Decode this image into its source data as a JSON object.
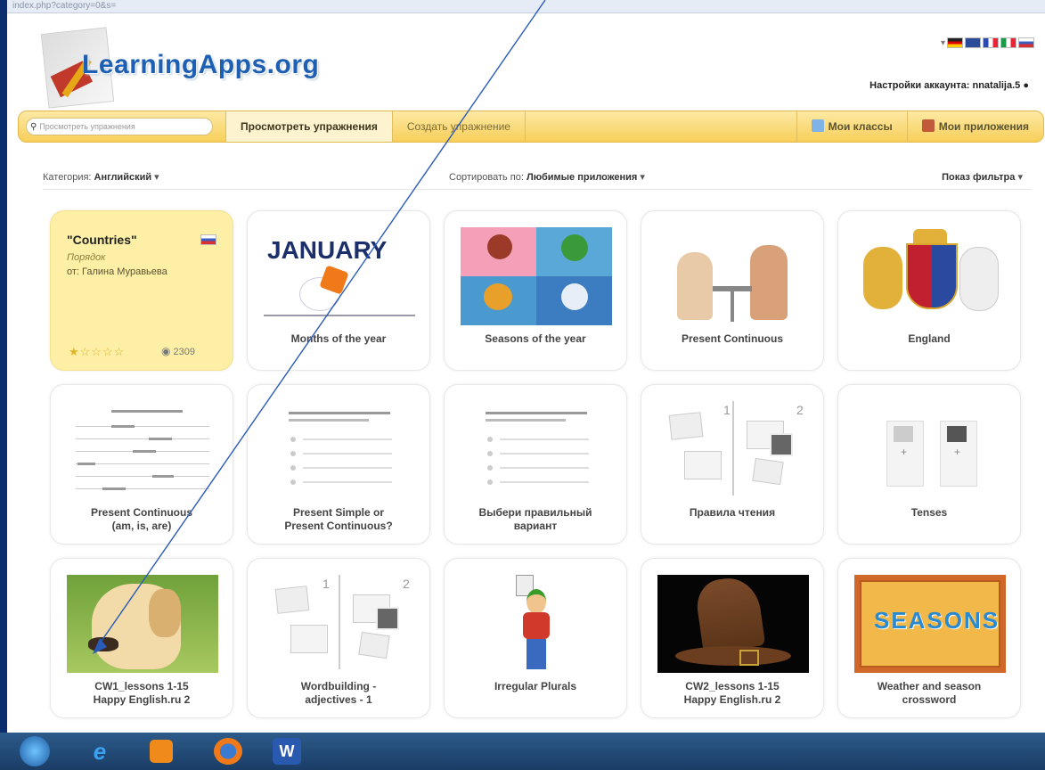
{
  "browser": {
    "url": "index.php?category=0&s="
  },
  "logo": {
    "text": "LearningApps.org"
  },
  "account": {
    "label": "Настройки аккаунта:",
    "user": "nnatalija.5"
  },
  "nav": {
    "search_placeholder": "Просмотреть упражнения",
    "browse": "Просмотреть упражнения",
    "create": "Создать упражнение",
    "classes": "Мои классы",
    "apps": "Мои приложения"
  },
  "filters": {
    "category_label": "Категория:",
    "category_value": "Английский",
    "sort_label": "Сортировать по:",
    "sort_value": "Любимые приложения",
    "filter_toggle": "Показ фильтра"
  },
  "featured": {
    "title": "\"Countries\"",
    "type": "Порядок",
    "author": "от: Галина Муравьева",
    "views": "2309",
    "rating": 1
  },
  "cards": [
    {
      "title1": "Months of the year",
      "title2": "",
      "thumb": "january"
    },
    {
      "title1": "Seasons of the year",
      "title2": "",
      "thumb": "seasons-trees"
    },
    {
      "title1": "Present Continuous",
      "title2": "",
      "thumb": "people"
    },
    {
      "title1": "England",
      "title2": "",
      "thumb": "coat-of-arms"
    },
    {
      "title1": "Present Continuous",
      "title2": "(am, is, are)",
      "thumb": "lines"
    },
    {
      "title1": "Present Simple or",
      "title2": "Present Continuous?",
      "thumb": "list"
    },
    {
      "title1": "Выбери правильный",
      "title2": "вариант",
      "thumb": "list"
    },
    {
      "title1": "Правила чтения",
      "title2": "",
      "thumb": "pairs"
    },
    {
      "title1": "Tenses",
      "title2": "",
      "thumb": "matching"
    },
    {
      "title1": "CW1_lessons 1-15",
      "title2": "Happy English.ru 2",
      "thumb": "dog"
    },
    {
      "title1": "Wordbuilding -",
      "title2": "adjectives - 1",
      "thumb": "pairs"
    },
    {
      "title1": "Irregular Plurals",
      "title2": "",
      "thumb": "boy"
    },
    {
      "title1": "CW2_lessons 1-15",
      "title2": "Happy English.ru 2",
      "thumb": "hat"
    },
    {
      "title1": "Weather and season",
      "title2": "crossword",
      "thumb": "seasons-word"
    }
  ],
  "thumb_text": {
    "january": "JANUARY",
    "seasons_word": "SEASONS"
  },
  "colors": {
    "nav_bg": "#f7cf5a",
    "highlight_card": "#fdf0a6",
    "logo_blue": "#1e5fb3",
    "arrow": "#2a5bb8"
  }
}
